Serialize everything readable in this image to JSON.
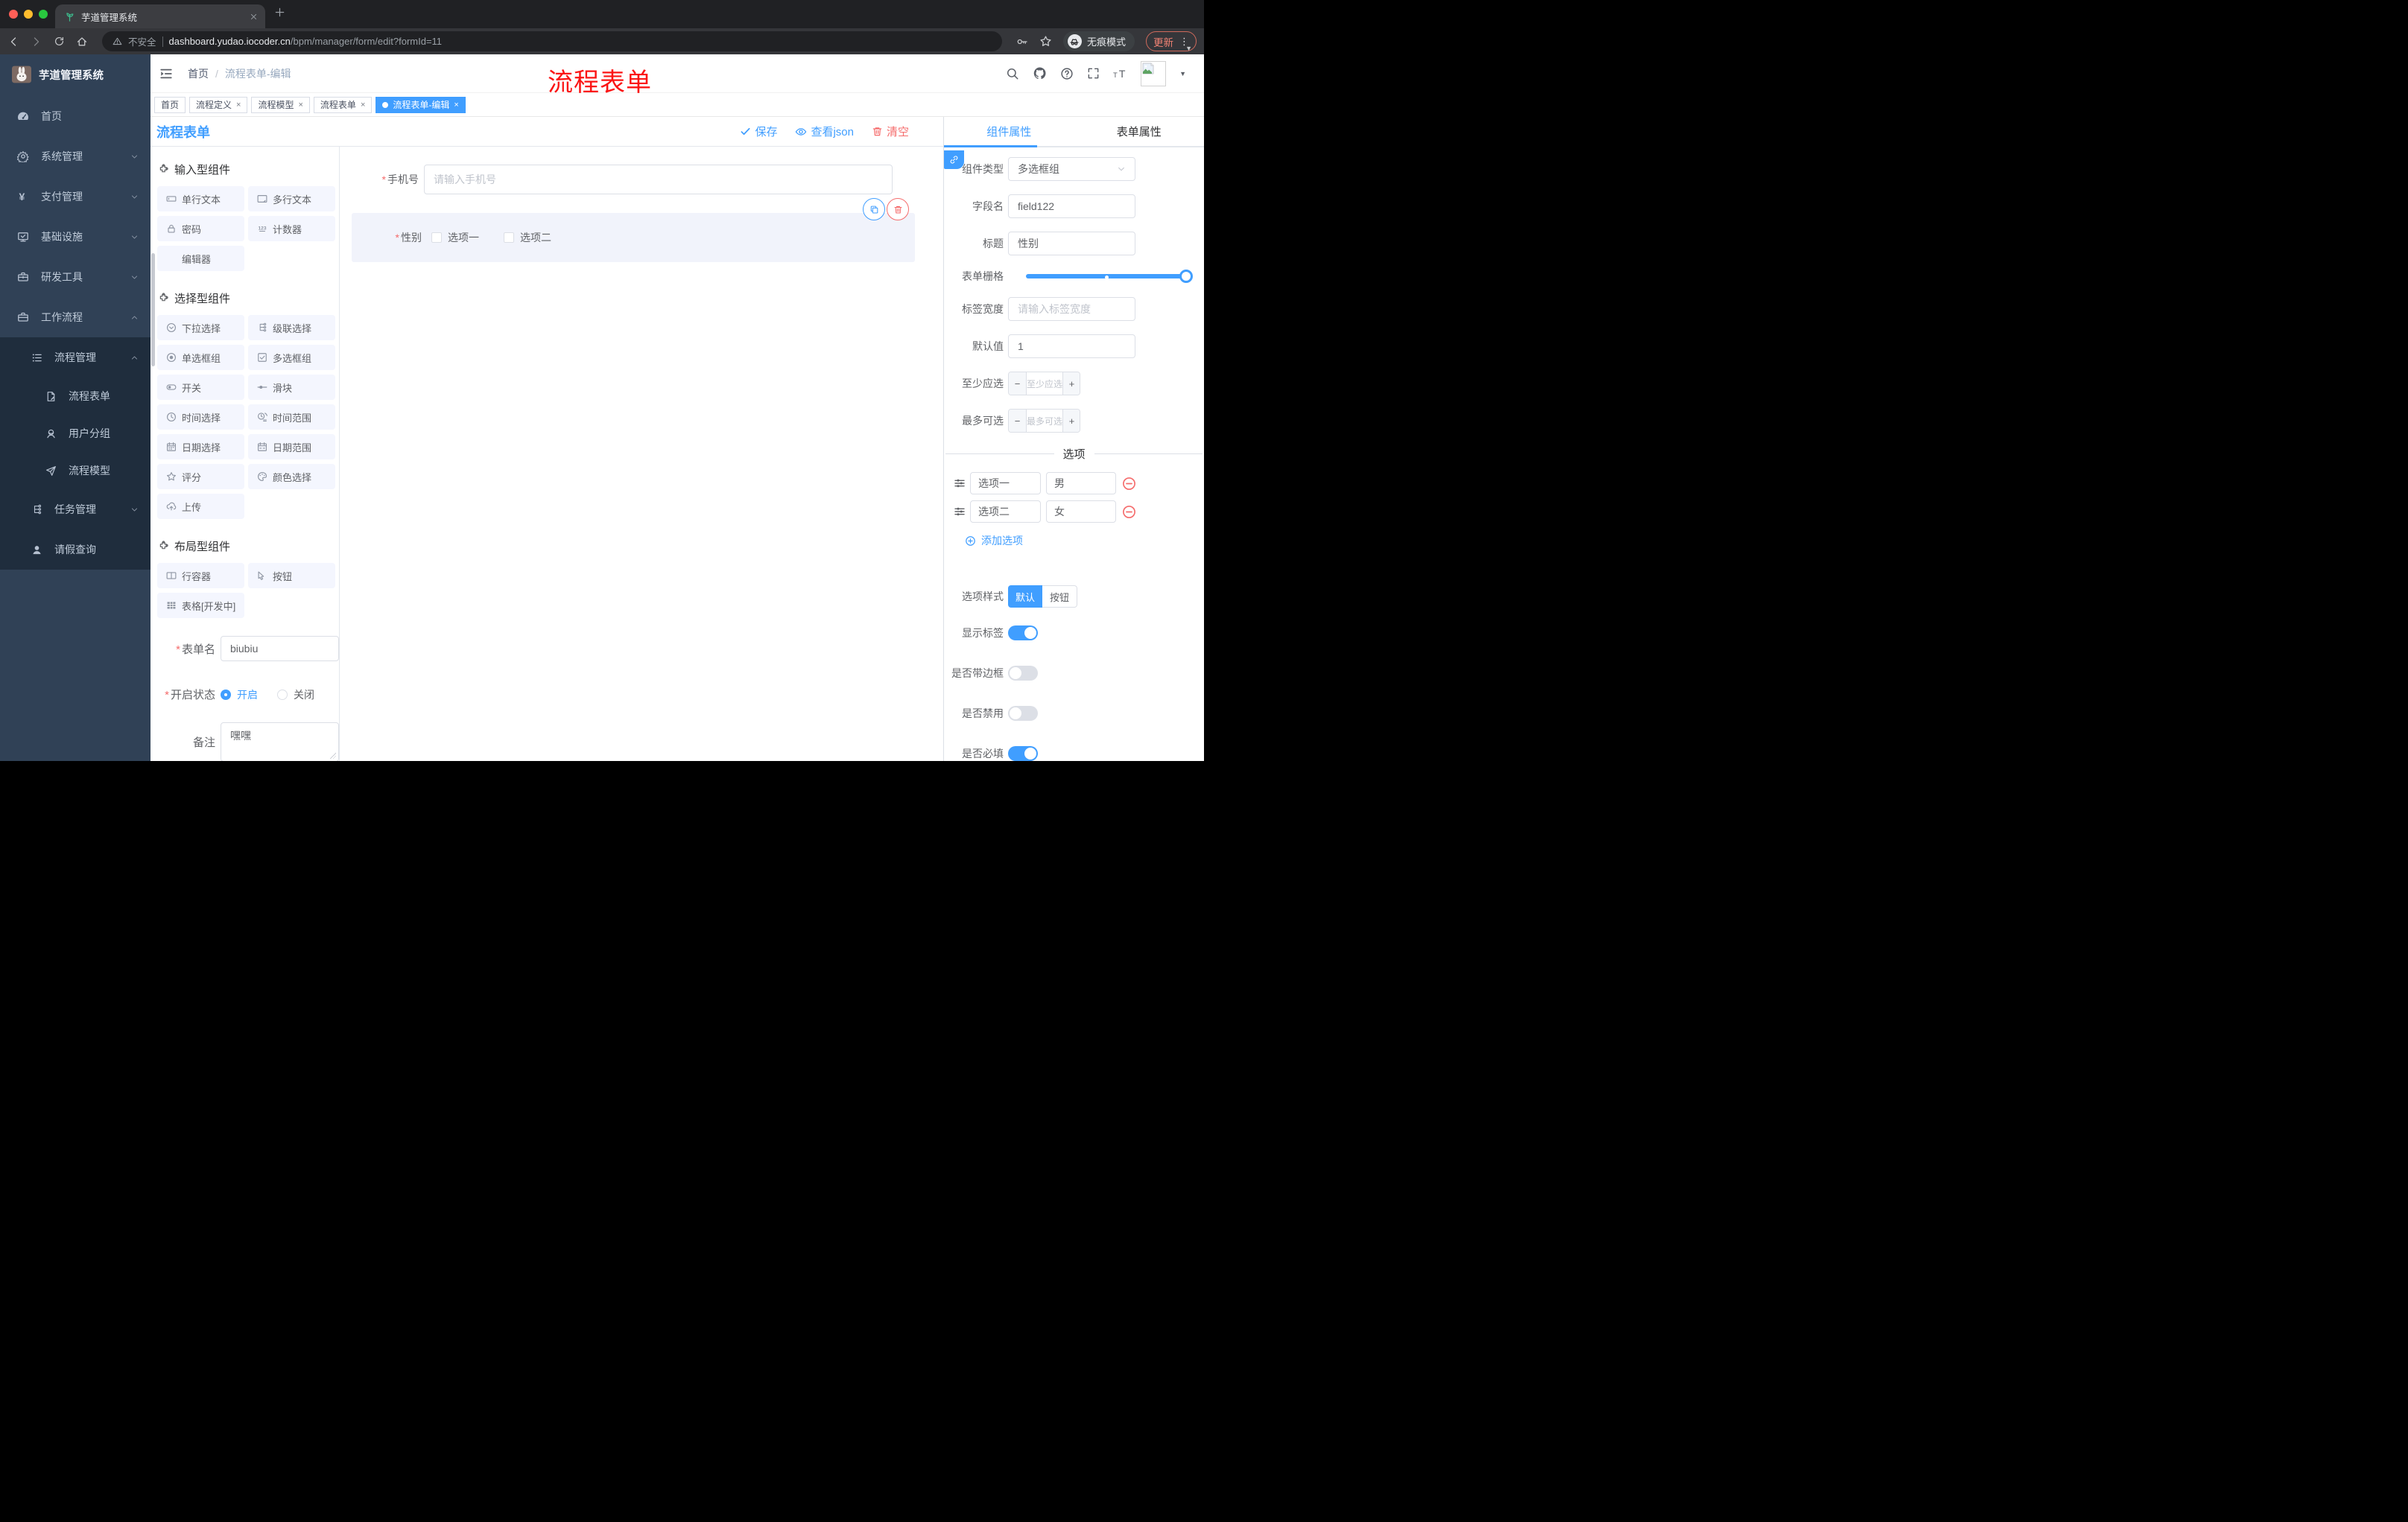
{
  "browser": {
    "tab_title": "芋道管理系统",
    "security_label": "不安全",
    "url_domain": "dashboard.yudao.iocoder.cn",
    "url_path": "/bpm/manager/form/edit?formId=11",
    "incognito_label": "无痕模式",
    "update_label": "更新"
  },
  "sidebar": {
    "logo_title": "芋道管理系统",
    "menu": [
      {
        "label": "首页",
        "icon": "dashboard",
        "level": 1,
        "sub": false,
        "chevron": ""
      },
      {
        "label": "系统管理",
        "icon": "gear",
        "level": 1,
        "sub": false,
        "chevron": "down"
      },
      {
        "label": "支付管理",
        "icon": "yen",
        "level": 1,
        "sub": false,
        "chevron": "down"
      },
      {
        "label": "基础设施",
        "icon": "monitor",
        "level": 1,
        "sub": false,
        "chevron": "down"
      },
      {
        "label": "研发工具",
        "icon": "toolbox",
        "level": 1,
        "sub": false,
        "chevron": "down"
      },
      {
        "label": "工作流程",
        "icon": "briefcase",
        "level": 1,
        "sub": false,
        "chevron": "up"
      },
      {
        "label": "流程管理",
        "icon": "list",
        "level": 2,
        "sub": true,
        "chevron": "up"
      },
      {
        "label": "流程表单",
        "icon": "doc",
        "level": 3,
        "sub": true,
        "chevron": ""
      },
      {
        "label": "用户分组",
        "icon": "people",
        "level": 3,
        "sub": true,
        "chevron": ""
      },
      {
        "label": "流程模型",
        "icon": "send",
        "level": 3,
        "sub": true,
        "chevron": ""
      },
      {
        "label": "任务管理",
        "icon": "tree",
        "level": 2,
        "sub": true,
        "chevron": "down"
      },
      {
        "label": "请假查询",
        "icon": "user",
        "level": 2,
        "sub": true,
        "chevron": ""
      }
    ]
  },
  "header": {
    "breadcrumb_home": "首页",
    "breadcrumb_sep": "/",
    "breadcrumb_current": "流程表单-编辑",
    "watermark": "流程表单"
  },
  "tags": [
    {
      "label": "首页",
      "closable": false,
      "active": false
    },
    {
      "label": "流程定义",
      "closable": true,
      "active": false
    },
    {
      "label": "流程模型",
      "closable": true,
      "active": false
    },
    {
      "label": "流程表单",
      "closable": true,
      "active": false
    },
    {
      "label": "流程表单-编辑",
      "closable": true,
      "active": true
    }
  ],
  "designer": {
    "page_title": "流程表单",
    "toolbar": {
      "save": "保存",
      "view_json": "查看json",
      "clear": "清空"
    },
    "palette": {
      "sections": [
        {
          "title": "输入型组件",
          "items": [
            {
              "label": "单行文本",
              "icon": "inputbox"
            },
            {
              "label": "多行文本",
              "icon": "textarea"
            },
            {
              "label": "密码",
              "icon": "lock"
            },
            {
              "label": "计数器",
              "icon": "counter"
            },
            {
              "label": "编辑器",
              "icon": "none"
            }
          ]
        },
        {
          "title": "选择型组件",
          "items": [
            {
              "label": "下拉选择",
              "icon": "selectIcon"
            },
            {
              "label": "级联选择",
              "icon": "cascade"
            },
            {
              "label": "单选框组",
              "icon": "radioIcon"
            },
            {
              "label": "多选框组",
              "icon": "checkboxIcon"
            },
            {
              "label": "开关",
              "icon": "switchIcon"
            },
            {
              "label": "滑块",
              "icon": "sliderIcon"
            },
            {
              "label": "时间选择",
              "icon": "clock"
            },
            {
              "label": "时间范围",
              "icon": "clockrange"
            },
            {
              "label": "日期选择",
              "icon": "calendar"
            },
            {
              "label": "日期范围",
              "icon": "calendarrange"
            },
            {
              "label": "评分",
              "icon": "star"
            },
            {
              "label": "颜色选择",
              "icon": "paletteIcon"
            },
            {
              "label": "上传",
              "icon": "upload"
            }
          ]
        },
        {
          "title": "布局型组件",
          "items": [
            {
              "label": "行容器",
              "icon": "rowIcon"
            },
            {
              "label": "按钮",
              "icon": "pointer"
            },
            {
              "label": "表格[开发中]",
              "icon": "tableIcon"
            }
          ]
        }
      ]
    },
    "form_meta": {
      "name_label": "表单名",
      "name_value": "biubiu",
      "status_label": "开启状态",
      "status_on": "开启",
      "status_off": "关闭",
      "remark_label": "备注",
      "remark_value": "嘿嘿"
    },
    "canvas": {
      "phone_label": "手机号",
      "phone_placeholder": "请输入手机号",
      "gender_label": "性别",
      "gender_options": [
        "选项一",
        "选项二"
      ]
    }
  },
  "panel": {
    "tab_component": "组件属性",
    "tab_form": "表单属性",
    "component_type_label": "组件类型",
    "component_type_value": "多选框组",
    "field_label": "字段名",
    "field_value": "field122",
    "title_label": "标题",
    "title_value": "性别",
    "grid_label": "表单栅格",
    "label_width_label": "标签宽度",
    "label_width_placeholder": "请输入标签宽度",
    "default_label": "默认值",
    "default_value": "1",
    "min_label": "至少应选",
    "min_placeholder": "至少应选",
    "max_label": "最多可选",
    "max_placeholder": "最多可选",
    "options_title": "选项",
    "options": [
      {
        "label": "选项一",
        "value": "男"
      },
      {
        "label": "选项二",
        "value": "女"
      }
    ],
    "add_option": "添加选项",
    "style_label": "选项样式",
    "style_default": "默认",
    "style_button": "按钮",
    "toggles": [
      {
        "label": "显示标签",
        "on": true
      },
      {
        "label": "是否带边框",
        "on": false
      },
      {
        "label": "是否禁用",
        "on": false
      },
      {
        "label": "是否必填",
        "on": true
      }
    ],
    "colors": {
      "accent": "#409eff",
      "danger": "#f56c6c"
    }
  }
}
